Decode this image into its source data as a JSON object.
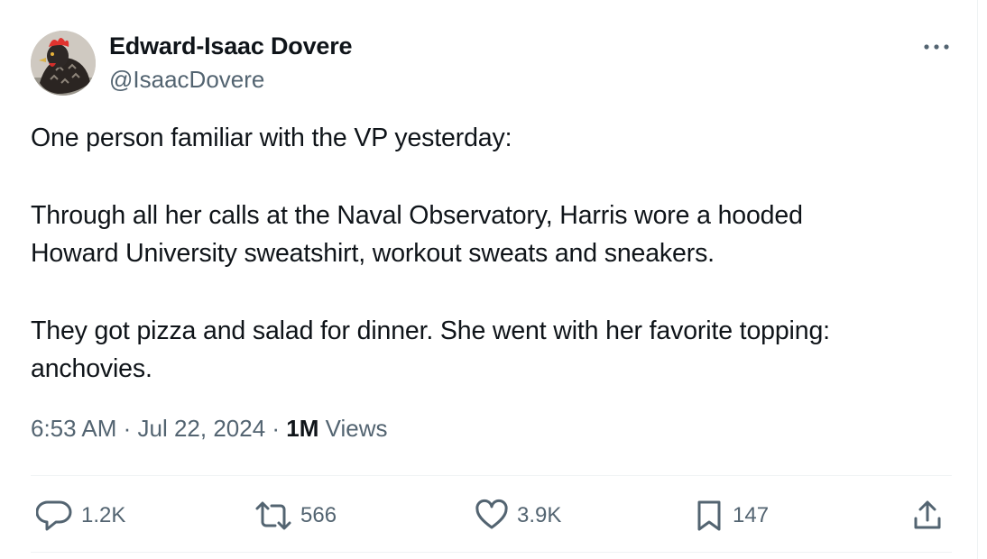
{
  "author": {
    "name": "Edward-Isaac Dovere",
    "handle": "@IsaacDovere",
    "avatar_icon": "rooster-avatar"
  },
  "tweet": {
    "paragraphs": [
      "One person familiar with the VP yesterday:",
      "Through all her calls at the Naval Observatory, Harris wore a hooded\nHoward University sweatshirt, workout sweats and sneakers.",
      "They got pizza and salad for dinner. She went with her favorite topping:\nanchovies."
    ]
  },
  "meta": {
    "time": "6:53 AM",
    "separator": " · ",
    "date": "Jul 22, 2024",
    "views_count": "1M",
    "views_label": " Views"
  },
  "actions": {
    "reply": {
      "icon": "reply-icon",
      "count": "1.2K"
    },
    "repost": {
      "icon": "repost-icon",
      "count": "566"
    },
    "like": {
      "icon": "heart-icon",
      "count": "3.9K"
    },
    "bookmark": {
      "icon": "bookmark-icon",
      "count": "147"
    },
    "share": {
      "icon": "share-icon"
    }
  },
  "colors": {
    "text_primary": "#0f1419",
    "text_secondary": "#536471",
    "divider": "#eff3f4"
  }
}
